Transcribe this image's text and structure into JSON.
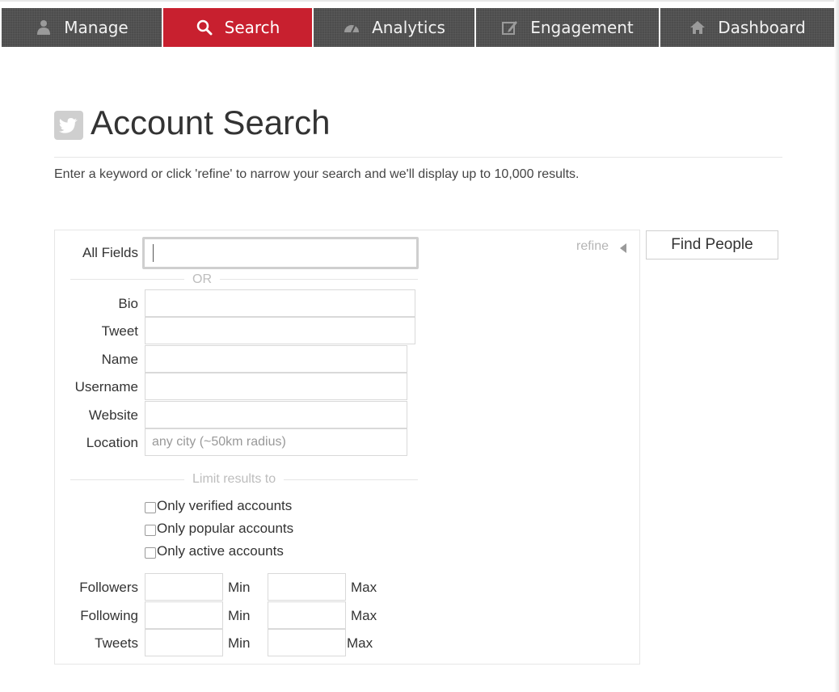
{
  "nav": {
    "items": [
      {
        "label": "Manage",
        "icon": "user-icon"
      },
      {
        "label": "Search",
        "icon": "search-icon",
        "active": true
      },
      {
        "label": "Analytics",
        "icon": "gauge-icon"
      },
      {
        "label": "Engagement",
        "icon": "edit-icon"
      },
      {
        "label": "Dashboard",
        "icon": "home-icon"
      }
    ]
  },
  "header": {
    "title": "Account Search",
    "icon": "twitter-bird-icon",
    "description": "Enter a keyword or click 'refine' to narrow your search and we'll display up to 10,000 results."
  },
  "form": {
    "all_fields_label": "All Fields",
    "all_fields_value": "",
    "or_label": "OR",
    "refine_label": "refine",
    "find_button": "Find People",
    "fields": [
      {
        "label": "Bio",
        "value": "",
        "placeholder": ""
      },
      {
        "label": "Tweet",
        "value": "",
        "placeholder": ""
      },
      {
        "label": "Name",
        "value": "",
        "placeholder": ""
      },
      {
        "label": "Username",
        "value": "",
        "placeholder": ""
      },
      {
        "label": "Website",
        "value": "",
        "placeholder": ""
      },
      {
        "label": "Location",
        "value": "",
        "placeholder": "any city (~50km radius)"
      }
    ],
    "limit_label": "Limit results to",
    "checkboxes": [
      {
        "label": "Only verified accounts",
        "checked": false
      },
      {
        "label": "Only popular accounts",
        "checked": false
      },
      {
        "label": "Only active accounts",
        "checked": false
      }
    ],
    "ranges": [
      {
        "label": "Followers",
        "min_label": "Min",
        "max_label": "Max"
      },
      {
        "label": "Following",
        "min_label": "Min",
        "max_label": "Max"
      },
      {
        "label": "Tweets",
        "min_label": "Min",
        "max_label": "Max"
      }
    ]
  },
  "colors": {
    "nav_bg": "#4d4d4d",
    "nav_active": "#c8202f",
    "text": "#333333",
    "muted": "#bdbdbd"
  }
}
